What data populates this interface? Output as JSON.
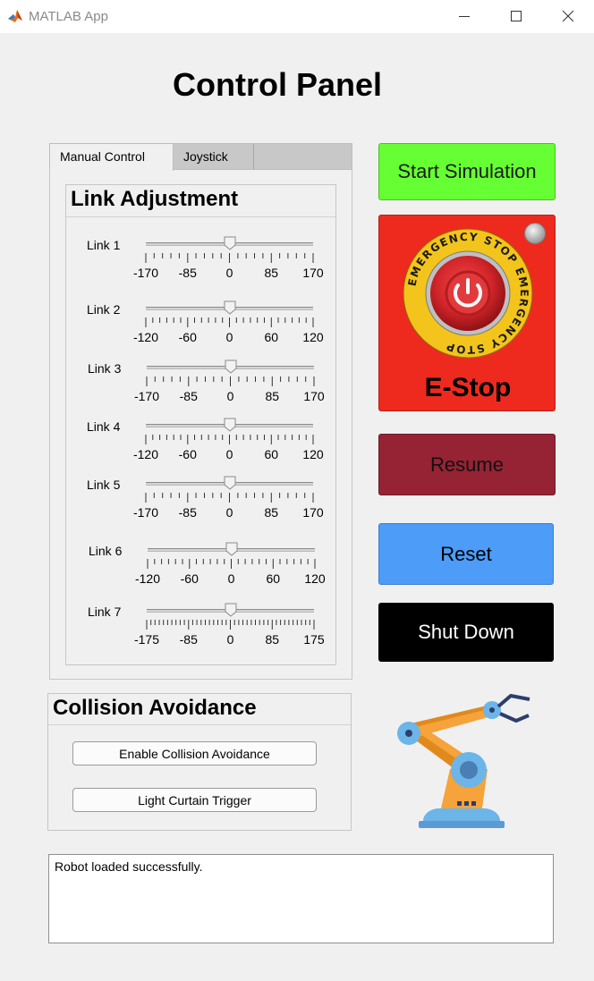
{
  "window": {
    "title": "MATLAB App",
    "icon": "matlab-membrane-icon",
    "controls": [
      "minimize-icon",
      "maximize-icon",
      "close-icon"
    ]
  },
  "page": {
    "title": "Control Panel"
  },
  "tabs": {
    "items": [
      {
        "label": "Manual Control",
        "selected": true
      },
      {
        "label": "Joystick",
        "selected": false
      }
    ]
  },
  "link_panel": {
    "title": "Link Adjustment",
    "sliders": [
      {
        "label": "Link 1",
        "value": 0,
        "min": -170,
        "max": 170,
        "tick_labels": [
          "-170",
          "-85",
          "0",
          "85",
          "170"
        ],
        "minor_ticks": 20
      },
      {
        "label": "Link 2",
        "value": 0,
        "min": -120,
        "max": 120,
        "tick_labels": [
          "-120",
          "-60",
          "0",
          "60",
          "120"
        ],
        "minor_ticks": 24
      },
      {
        "label": "Link 3",
        "value": 0,
        "min": -170,
        "max": 170,
        "tick_labels": [
          "-170",
          "-85",
          "0",
          "85",
          "170"
        ],
        "minor_ticks": 20
      },
      {
        "label": "Link 4",
        "value": 0,
        "min": -120,
        "max": 120,
        "tick_labels": [
          "-120",
          "-60",
          "0",
          "60",
          "120"
        ],
        "minor_ticks": 24
      },
      {
        "label": "Link 5",
        "value": 0,
        "min": -170,
        "max": 170,
        "tick_labels": [
          "-170",
          "-85",
          "0",
          "85",
          "170"
        ],
        "minor_ticks": 20
      },
      {
        "label": "Link 6",
        "value": 0,
        "min": -120,
        "max": 120,
        "tick_labels": [
          "-120",
          "-60",
          "0",
          "60",
          "120"
        ],
        "minor_ticks": 24
      },
      {
        "label": "Link 7",
        "value": 0,
        "min": -175,
        "max": 175,
        "tick_labels": [
          "-175",
          "-85",
          "0",
          "85",
          "175"
        ],
        "minor_ticks": 40
      }
    ]
  },
  "buttons": {
    "start": "Start Simulation",
    "estop": "E-Stop",
    "resume": "Resume",
    "reset": "Reset",
    "shutdown": "Shut Down"
  },
  "estop_image": {
    "ring_text": "EMERGENCY STOP EMERGENCY STOP",
    "ring_color": "#f3c41b",
    "button_color": "#d3262b",
    "icon": "emergency-stop-button-icon"
  },
  "collision_panel": {
    "title": "Collision Avoidance",
    "enable_button": "Enable Collision Avoidance",
    "curtain_button": "Light Curtain Trigger"
  },
  "robot_image": {
    "icon": "robot-arm-icon"
  },
  "status": {
    "text": "Robot loaded successfully."
  }
}
